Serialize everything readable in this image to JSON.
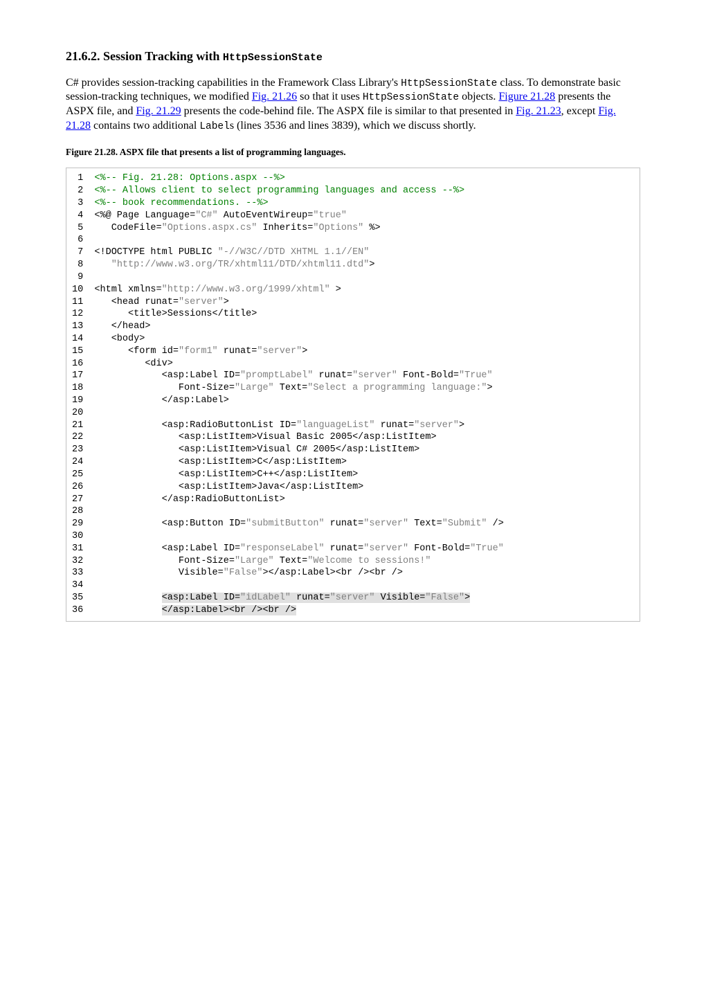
{
  "heading": {
    "number": "21.6.2. Session Tracking with ",
    "mono": "HttpSessionState"
  },
  "paragraph": {
    "p1": "C# provides session-tracking capabilities in the Framework Class Library's ",
    "p2": " class. To demonstrate basic session-tracking techniques, we modified ",
    "mono1": "HttpSessionState",
    "link1": "Fig. 21.26",
    "p3": " so that it uses ",
    "mono2": "HttpSessionState",
    "p4": " objects. ",
    "link2": "Figure 21.28",
    "p5": " presents the ASPX file, and ",
    "link3": "Fig. 21.29",
    "p6": " presents the code-behind file. The ASPX file is similar to that presented in ",
    "link4": "Fig. 21.23",
    "p7": ", except ",
    "link5": "Fig. 21.28",
    "p8": " contains two additional ",
    "mono3": "Label",
    "p9": "s (lines 3536 and lines 3839), which we discuss shortly."
  },
  "figure_caption": "Figure 21.28. ASPX file that presents a list of programming languages.",
  "code": {
    "l01a": " 1  ",
    "l01b": "<%-- Fig. 21.28: Options.aspx --%>",
    "l02a": " 2  ",
    "l02b": "<%-- Allows client to select programming languages and access --%>",
    "l03a": " 3  ",
    "l03b": "<%-- book recommendations. --%>",
    "l04a": " 4  <%@ Page Language=",
    "l04b": "\"C#\"",
    "l04c": " AutoEventWireup=",
    "l04d": "\"true\"",
    "l05a": " 5     CodeFile=",
    "l05b": "\"Options.aspx.cs\"",
    "l05c": " Inherits=",
    "l05d": "\"Options\"",
    "l05e": " %>",
    "l06": " 6",
    "l07a": " 7  <!DOCTYPE html PUBLIC ",
    "l07b": "\"-//W3C//DTD XHTML 1.1//EN\"",
    "l08a": " 8     ",
    "l08b": "\"http://www.w3.org/TR/xhtml11/DTD/xhtml11.dtd\"",
    "l08c": ">",
    "l09": " 9",
    "l10a": "10  <html xmlns=",
    "l10b": "\"http://www.w3.org/1999/xhtml\"",
    "l10c": " >",
    "l11a": "11     <head runat=",
    "l11b": "\"server\"",
    "l11c": ">",
    "l12": "12        <title>Sessions</title>",
    "l13": "13     </head>",
    "l14": "14     <body>",
    "l15a": "15        <form id=",
    "l15b": "\"form1\"",
    "l15c": " runat=",
    "l15d": "\"server\"",
    "l15e": ">",
    "l16": "16           <div>",
    "l17a": "17              <asp:Label ID=",
    "l17b": "\"promptLabel\"",
    "l17c": " runat=",
    "l17d": "\"server\"",
    "l17e": " Font-Bold=",
    "l17f": "\"True\"",
    "l18a": "18                 Font-Size=",
    "l18b": "\"Large\"",
    "l18c": " Text=",
    "l18d": "\"Select a programming language:\"",
    "l18e": ">",
    "l19": "19              </asp:Label>",
    "l20": "20",
    "l21a": "21              <asp:RadioButtonList ID=",
    "l21b": "\"languageList\"",
    "l21c": " runat=",
    "l21d": "\"server\"",
    "l21e": ">",
    "l22": "22                 <asp:ListItem>Visual Basic 2005</asp:ListItem>",
    "l23": "23                 <asp:ListItem>Visual C# 2005</asp:ListItem>",
    "l24": "24                 <asp:ListItem>C</asp:ListItem>",
    "l25": "25                 <asp:ListItem>C++</asp:ListItem>",
    "l26": "26                 <asp:ListItem>Java</asp:ListItem>",
    "l27": "27              </asp:RadioButtonList>",
    "l28": "28",
    "l29a": "29              <asp:Button ID=",
    "l29b": "\"submitButton\"",
    "l29c": " runat=",
    "l29d": "\"server\"",
    "l29e": " Text=",
    "l29f": "\"Submit\"",
    "l29g": " />",
    "l30": "30",
    "l31a": "31              <asp:Label ID=",
    "l31b": "\"responseLabel\"",
    "l31c": " runat=",
    "l31d": "\"server\"",
    "l31e": " Font-Bold=",
    "l31f": "\"True\"",
    "l32a": "32                 Font-Size=",
    "l32b": "\"Large\"",
    "l32c": " Text=",
    "l32d": "\"Welcome to sessions!\"",
    "l33a": "33                 Visible=",
    "l33b": "\"False\"",
    "l33c": "></asp:Label><br /><br />",
    "l34": "34",
    "l35a": "35              ",
    "l35b": "<asp:Label ID=",
    "l35c": "\"idLabel\"",
    "l35d": " runat=",
    "l35e": "\"server\"",
    "l35f": " Visible=",
    "l35g": "\"False\"",
    "l35h": ">",
    "l36a": "36              ",
    "l36b": "</asp:Label><br /><br />"
  }
}
